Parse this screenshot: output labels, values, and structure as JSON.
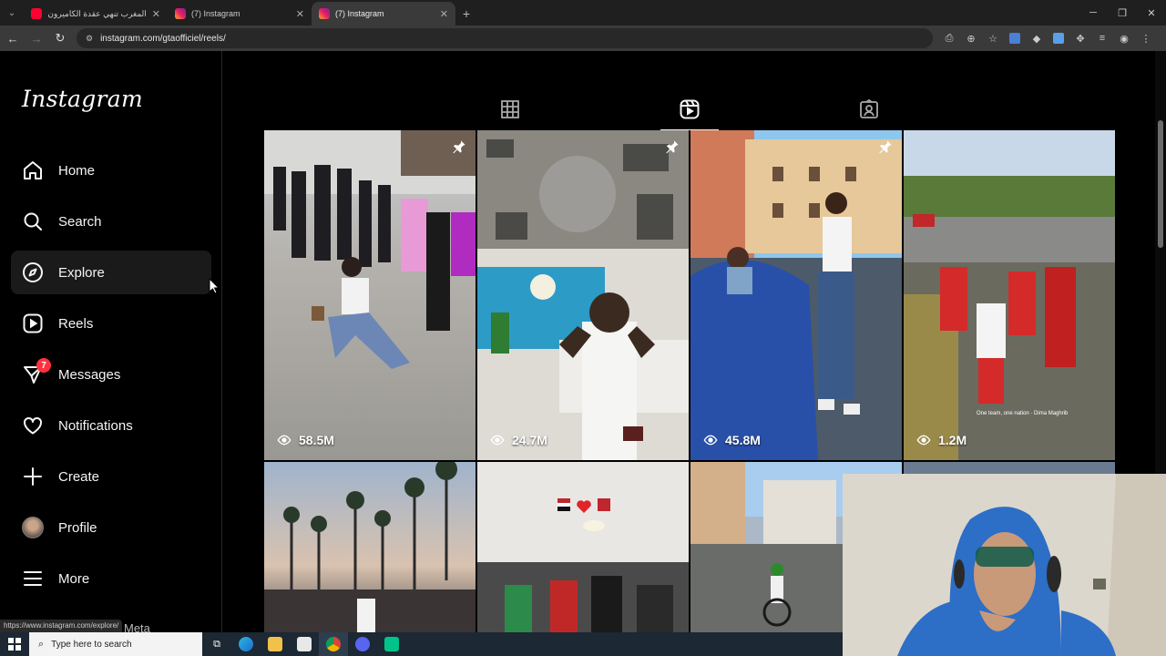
{
  "browser": {
    "tabs": [
      {
        "title": "المغرب تنهي عقدة الكاميرون تتأ..",
        "favicon": "youtube-icon",
        "active": false
      },
      {
        "title": "(7) Instagram",
        "favicon": "instagram-icon",
        "active": false
      },
      {
        "title": "(7) Instagram",
        "favicon": "instagram-icon",
        "active": true
      }
    ],
    "new_tab": "+",
    "url": "instagram.com/gtaofficiel/reels/",
    "status_url": "https://www.instagram.com/explore/"
  },
  "instagram": {
    "logo": "Instagram",
    "nav": [
      {
        "label": "Home",
        "icon": "home-icon"
      },
      {
        "label": "Search",
        "icon": "search-icon"
      },
      {
        "label": "Explore",
        "icon": "compass-icon"
      },
      {
        "label": "Reels",
        "icon": "reels-icon"
      },
      {
        "label": "Messages",
        "icon": "messenger-icon",
        "badge": "7"
      },
      {
        "label": "Notifications",
        "icon": "heart-icon"
      },
      {
        "label": "Create",
        "icon": "plus-icon"
      },
      {
        "label": "Profile",
        "icon": "avatar"
      },
      {
        "label": "More",
        "icon": "menu-icon"
      }
    ],
    "meta_label": "Meta",
    "profile_tabs": [
      "posts-grid-icon",
      "reels-icon",
      "tagged-icon"
    ],
    "reels": [
      {
        "views": "58.5M",
        "pinned": true
      },
      {
        "views": "24.7M",
        "pinned": true
      },
      {
        "views": "45.8M",
        "pinned": true
      },
      {
        "views": "1.2M",
        "pinned": false
      },
      {
        "views": "",
        "pinned": false
      },
      {
        "views": "",
        "pinned": false
      },
      {
        "views": "",
        "pinned": false
      }
    ],
    "overlay_caption": "One team, one nation · Dima Maghrib"
  },
  "taskbar": {
    "search_placeholder": "Type here to search"
  },
  "colors": {
    "background": "#000000",
    "badge": "#ff3040",
    "chrome_dark": "#1f1f1f",
    "chrome_toolbar": "#3a3a3a"
  }
}
